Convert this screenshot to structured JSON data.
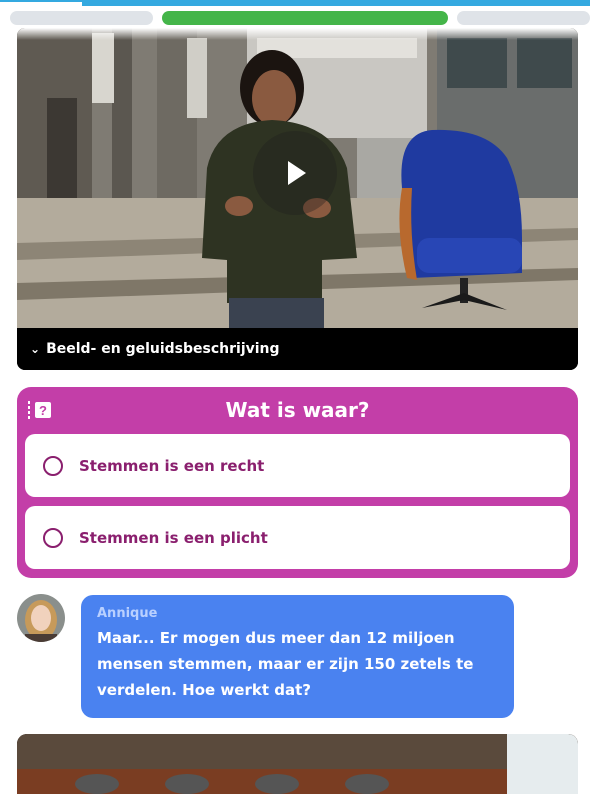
{
  "progress": {
    "segments": 3,
    "active_index": 1
  },
  "video": {
    "play_label": "Afspelen",
    "description_toggle": "Beeld- en geluidsbeschrijving"
  },
  "quiz": {
    "title": "Wat is waar?",
    "icon": "quiz-question-icon",
    "options": [
      {
        "label": "Stemmen is een recht"
      },
      {
        "label": "Stemmen is een plicht"
      }
    ],
    "colors": {
      "card": "#c33ea8",
      "text": "#8a1f6e"
    }
  },
  "chat": {
    "author": "Annique",
    "message": "Maar... Er mogen dus meer dan 12 miljoen mensen stemmen, maar er zijn 150 zetels te verdelen. Hoe werkt dat?",
    "bubble_color": "#4a82f0"
  }
}
